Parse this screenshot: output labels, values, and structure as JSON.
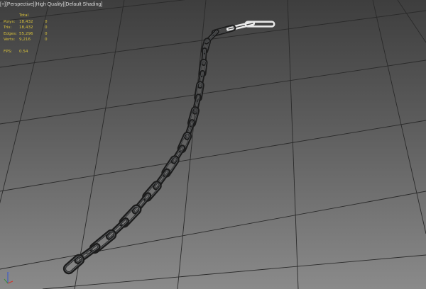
{
  "viewport": {
    "label_prefix": "[+]",
    "label_view": "[Perspective]",
    "label_quality": "[High Quality]",
    "label_shading": "[Default Shading]"
  },
  "stats": {
    "header": "Total",
    "polys_label": "Polys:",
    "polys_total": "18,432",
    "polys_sel": "0",
    "tris_label": "Tris:",
    "tris_total": "18,432",
    "tris_sel": "0",
    "edges_label": "Edges:",
    "edges_total": "55,296",
    "edges_sel": "0",
    "verts_label": "Verts:",
    "verts_total": "9,216",
    "verts_sel": "0",
    "fps_label": "FPS:",
    "fps_value": "0.54"
  },
  "colors": {
    "stats_text": "#d9c23a",
    "grid_line": "#2a2a2a",
    "chain_metal": "#1c1c1c",
    "chain_highlight": "#9aa0a6",
    "selected_link": "#e6e6e6",
    "axis_x": "#d0342c",
    "axis_y": "#3a8a3a",
    "axis_z": "#3355cc"
  },
  "scene": {
    "object": "chain-mesh",
    "link_count": 23
  }
}
